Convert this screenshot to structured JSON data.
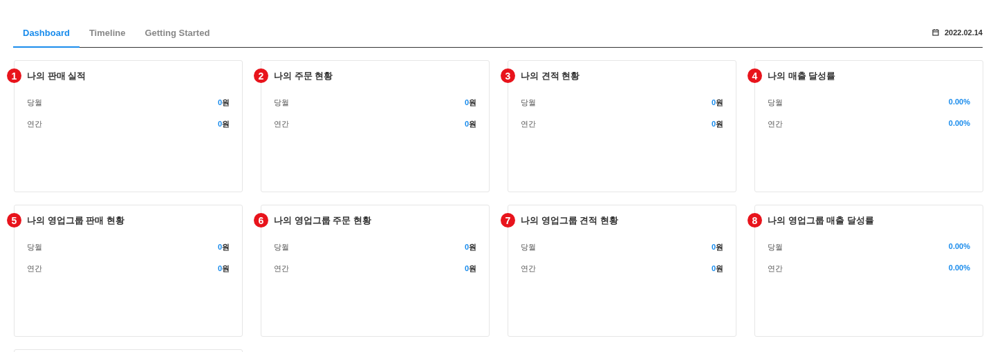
{
  "tabs": [
    {
      "label": "Dashboard",
      "selected": true
    },
    {
      "label": "Timeline",
      "selected": false
    },
    {
      "label": "Getting Started",
      "selected": false
    }
  ],
  "date": "2022.02.14",
  "cards": [
    {
      "number": "1",
      "title": "나의 판매 실적",
      "rows": [
        {
          "label": "당월",
          "value": "0",
          "unit": "원"
        },
        {
          "label": "연간",
          "value": "0",
          "unit": "원"
        }
      ]
    },
    {
      "number": "2",
      "title": "나의 주문 현황",
      "rows": [
        {
          "label": "당월",
          "value": "0",
          "unit": "원"
        },
        {
          "label": "연간",
          "value": "0",
          "unit": "원"
        }
      ]
    },
    {
      "number": "3",
      "title": "나의 견적 현황",
      "rows": [
        {
          "label": "당월",
          "value": "0",
          "unit": "원"
        },
        {
          "label": "연간",
          "value": "0",
          "unit": "원"
        }
      ]
    },
    {
      "number": "4",
      "title": "나의 매출 달성률",
      "rows": [
        {
          "label": "당월",
          "value": "0.00%"
        },
        {
          "label": "연간",
          "value": "0.00%"
        }
      ]
    },
    {
      "number": "5",
      "title": "나의 영업그룹 판매 현황",
      "rows": [
        {
          "label": "당월",
          "value": "0",
          "unit": "원"
        },
        {
          "label": "연간",
          "value": "0",
          "unit": "원"
        }
      ]
    },
    {
      "number": "6",
      "title": "나의 영업그룹 주문 현황",
      "rows": [
        {
          "label": "당월",
          "value": "0",
          "unit": "원"
        },
        {
          "label": "연간",
          "value": "0",
          "unit": "원"
        }
      ]
    },
    {
      "number": "7",
      "title": "나의 영업그룹 견적 현황",
      "rows": [
        {
          "label": "당월",
          "value": "0",
          "unit": "원"
        },
        {
          "label": "연간",
          "value": "0",
          "unit": "원"
        }
      ]
    },
    {
      "number": "8",
      "title": "나의 영업그룹 매출 달성률",
      "rows": [
        {
          "label": "당월",
          "value": "0.00%"
        },
        {
          "label": "연간",
          "value": "0.00%"
        }
      ]
    }
  ]
}
